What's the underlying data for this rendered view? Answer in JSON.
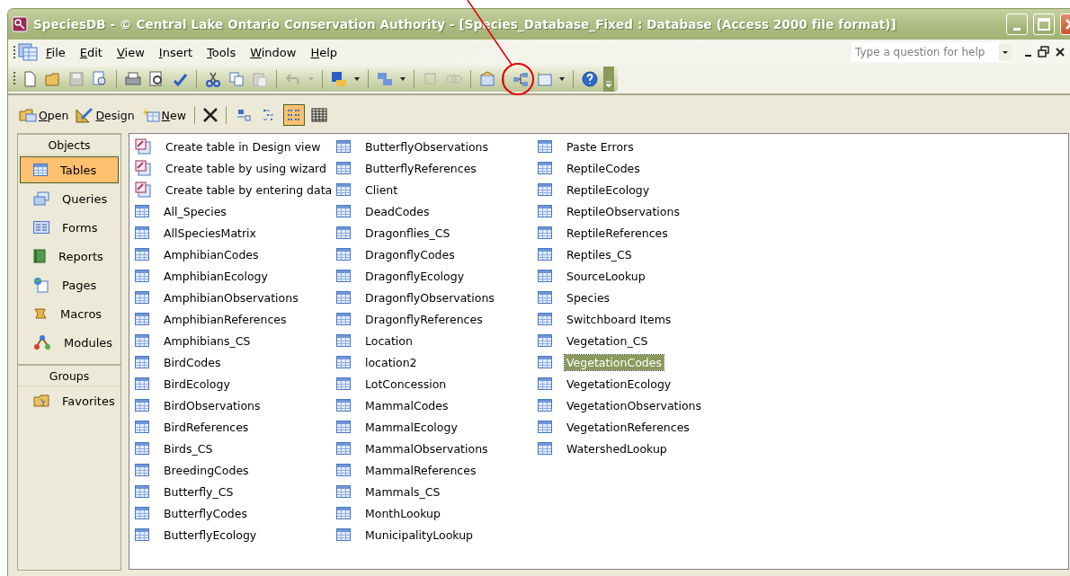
{
  "window": {
    "title": "SpeciesDB - © Central Lake Ontario Conservation Authority - [Species_Database_Fixed : Database (Access 2000 file format)]"
  },
  "menu": [
    "File",
    "Edit",
    "View",
    "Insert",
    "Tools",
    "Window",
    "Help"
  ],
  "help_box": {
    "placeholder": "Type a question for help"
  },
  "object_toolbar": {
    "buttons": [
      {
        "kind": "open",
        "label": "Open"
      },
      {
        "kind": "design",
        "label": "Design"
      },
      {
        "kind": "new",
        "label": "New"
      }
    ],
    "views": [
      {
        "kind": "large",
        "selected": false
      },
      {
        "kind": "small",
        "selected": false
      },
      {
        "kind": "list",
        "selected": true
      },
      {
        "kind": "details",
        "selected": false
      }
    ]
  },
  "sidebar": {
    "sections": [
      {
        "title": "Objects",
        "items": [
          {
            "kind": "table",
            "label": "Tables",
            "selected": true
          },
          {
            "kind": "query",
            "label": "Queries",
            "selected": false
          },
          {
            "kind": "form",
            "label": "Forms",
            "selected": false
          },
          {
            "kind": "report",
            "label": "Reports",
            "selected": false
          },
          {
            "kind": "page",
            "label": "Pages",
            "selected": false
          },
          {
            "kind": "macro",
            "label": "Macros",
            "selected": false
          },
          {
            "kind": "module",
            "label": "Modules",
            "selected": false
          }
        ]
      },
      {
        "title": "Groups",
        "items": [
          {
            "kind": "favorites",
            "label": "Favorites",
            "selected": false
          }
        ]
      }
    ]
  },
  "objects": [
    {
      "kind": "shortcut",
      "label": "Create table in Design view",
      "selected": false
    },
    {
      "kind": "shortcut",
      "label": "Create table by using wizard",
      "selected": false
    },
    {
      "kind": "shortcut",
      "label": "Create table by entering data",
      "selected": false
    },
    {
      "kind": "table",
      "label": "All_Species",
      "selected": false
    },
    {
      "kind": "table",
      "label": "AllSpeciesMatrix",
      "selected": false
    },
    {
      "kind": "table",
      "label": "AmphibianCodes",
      "selected": false
    },
    {
      "kind": "table",
      "label": "AmphibianEcology",
      "selected": false
    },
    {
      "kind": "table",
      "label": "AmphibianObservations",
      "selected": false
    },
    {
      "kind": "table",
      "label": "AmphibianReferences",
      "selected": false
    },
    {
      "kind": "table",
      "label": "Amphibians_CS",
      "selected": false
    },
    {
      "kind": "table",
      "label": "BirdCodes",
      "selected": false
    },
    {
      "kind": "table",
      "label": "BirdEcology",
      "selected": false
    },
    {
      "kind": "table",
      "label": "BirdObservations",
      "selected": false
    },
    {
      "kind": "table",
      "label": "BirdReferences",
      "selected": false
    },
    {
      "kind": "table",
      "label": "Birds_CS",
      "selected": false
    },
    {
      "kind": "table",
      "label": "BreedingCodes",
      "selected": false
    },
    {
      "kind": "table",
      "label": "Butterfly_CS",
      "selected": false
    },
    {
      "kind": "table",
      "label": "ButterflyCodes",
      "selected": false
    },
    {
      "kind": "table",
      "label": "ButterflyEcology",
      "selected": false
    },
    {
      "kind": "table",
      "label": "ButterflyObservations",
      "selected": false
    },
    {
      "kind": "table",
      "label": "ButterflyReferences",
      "selected": false
    },
    {
      "kind": "table",
      "label": "Client",
      "selected": false
    },
    {
      "kind": "table",
      "label": "DeadCodes",
      "selected": false
    },
    {
      "kind": "table",
      "label": "Dragonflies_CS",
      "selected": false
    },
    {
      "kind": "table",
      "label": "DragonflyCodes",
      "selected": false
    },
    {
      "kind": "table",
      "label": "DragonflyEcology",
      "selected": false
    },
    {
      "kind": "table",
      "label": "DragonflyObservations",
      "selected": false
    },
    {
      "kind": "table",
      "label": "DragonflyReferences",
      "selected": false
    },
    {
      "kind": "table",
      "label": "Location",
      "selected": false
    },
    {
      "kind": "table",
      "label": "location2",
      "selected": false
    },
    {
      "kind": "table",
      "label": "LotConcession",
      "selected": false
    },
    {
      "kind": "table",
      "label": "MammalCodes",
      "selected": false
    },
    {
      "kind": "table",
      "label": "MammalEcology",
      "selected": false
    },
    {
      "kind": "table",
      "label": "MammalObservations",
      "selected": false
    },
    {
      "kind": "table",
      "label": "MammalReferences",
      "selected": false
    },
    {
      "kind": "table",
      "label": "Mammals_CS",
      "selected": false
    },
    {
      "kind": "table",
      "label": "MonthLookup",
      "selected": false
    },
    {
      "kind": "table",
      "label": "MunicipalityLookup",
      "selected": false
    },
    {
      "kind": "table",
      "label": "Paste Errors",
      "selected": false
    },
    {
      "kind": "table",
      "label": "ReptileCodes",
      "selected": false
    },
    {
      "kind": "table",
      "label": "ReptileEcology",
      "selected": false
    },
    {
      "kind": "table",
      "label": "ReptileObservations",
      "selected": false
    },
    {
      "kind": "table",
      "label": "ReptileReferences",
      "selected": false
    },
    {
      "kind": "table",
      "label": "Reptiles_CS",
      "selected": false
    },
    {
      "kind": "table",
      "label": "SourceLookup",
      "selected": false
    },
    {
      "kind": "table",
      "label": "Species",
      "selected": false
    },
    {
      "kind": "table",
      "label": "Switchboard Items",
      "selected": false
    },
    {
      "kind": "table",
      "label": "Vegetation_CS",
      "selected": false
    },
    {
      "kind": "table",
      "label": "VegetationCodes",
      "selected": true
    },
    {
      "kind": "table",
      "label": "VegetationEcology",
      "selected": false
    },
    {
      "kind": "table",
      "label": "VegetationObservations",
      "selected": false
    },
    {
      "kind": "table",
      "label": "VegetationReferences",
      "selected": false
    },
    {
      "kind": "table",
      "label": "WatershedLookup",
      "selected": false
    }
  ]
}
